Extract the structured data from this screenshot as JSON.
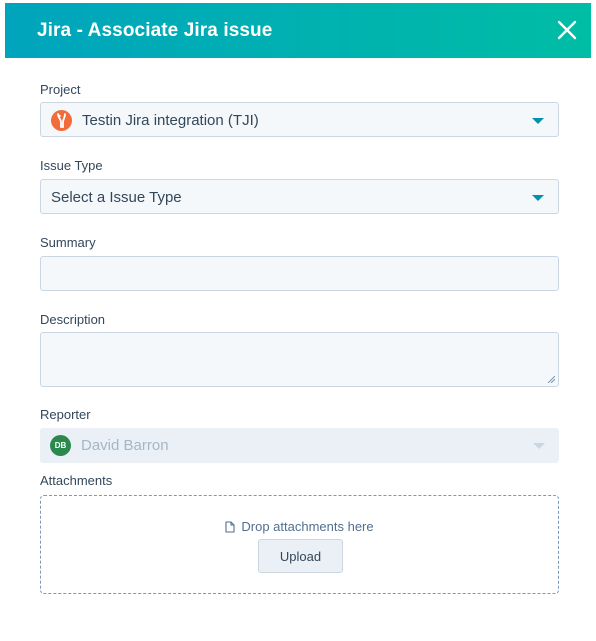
{
  "dialog": {
    "title": "Jira - Associate Jira issue",
    "close_icon": "close-icon"
  },
  "colors": {
    "header_start": "#00a4bd",
    "header_end": "#00bda5",
    "caret": "#0091ae",
    "project_icon": "#f26b3a",
    "avatar": "#2a8a4e"
  },
  "fields": {
    "project": {
      "label": "Project",
      "value": "Testin Jira integration (TJI)",
      "icon": "jira-project-icon"
    },
    "issue_type": {
      "label": "Issue Type",
      "value": "Select a Issue Type"
    },
    "summary": {
      "label": "Summary",
      "value": ""
    },
    "description": {
      "label": "Description",
      "value": ""
    },
    "reporter": {
      "label": "Reporter",
      "avatar_initials": "DB",
      "value": "David Barron"
    },
    "attachments": {
      "label": "Attachments",
      "drop_text": "Drop attachments here",
      "upload_label": "Upload",
      "icon": "file-icon"
    }
  }
}
